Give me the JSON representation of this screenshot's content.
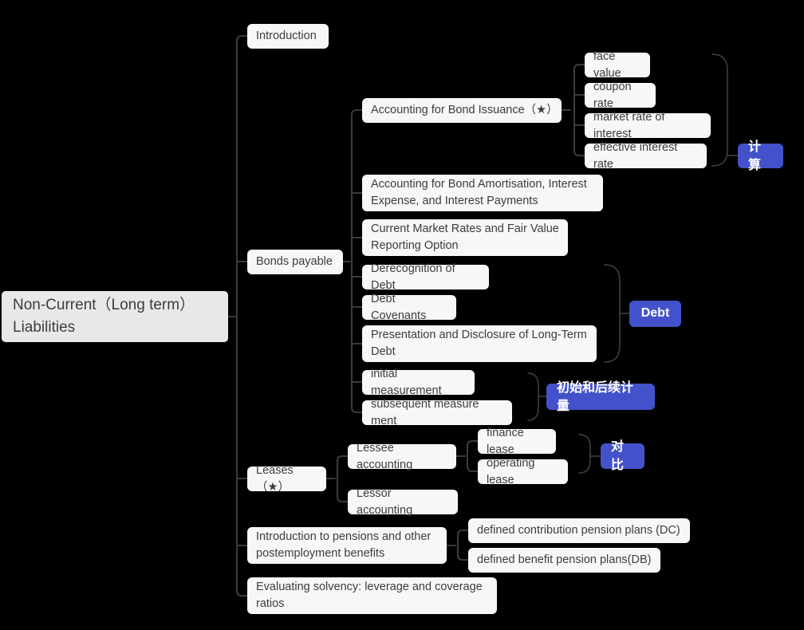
{
  "theme": {
    "background": "#000000",
    "node_bg": "#f7f7f7",
    "node_text": "#3c3c3c",
    "root_bg": "#e8e8e8",
    "badge_bg": "#4352ca",
    "badge_text": "#ffffff",
    "edge_color": "#3a3a3a"
  },
  "root": {
    "label": "Non-Current（Long term）\nLiabilities"
  },
  "branches": [
    {
      "id": "introduction",
      "label": "Introduction"
    },
    {
      "id": "bonds-payable",
      "label": "Bonds payable"
    },
    {
      "id": "leases",
      "label": "Leases（★）"
    },
    {
      "id": "pensions",
      "label": "Introduction to pensions and other\npostemployment benefits"
    },
    {
      "id": "solvency",
      "label": "Evaluating solvency: leverage and coverage\nratios"
    }
  ],
  "bonds_children": [
    {
      "id": "bond-issuance",
      "label": "Accounting for Bond Issuance（★）"
    },
    {
      "id": "bond-amortisation",
      "label": "Accounting for Bond Amortisation, Interest\nExpense, and Interest Payments"
    },
    {
      "id": "current-market-rates",
      "label": "Current Market Rates and Fair Value\nReporting Option"
    },
    {
      "id": "derecognition",
      "label": "Derecognition of Debt"
    },
    {
      "id": "debt-covenants",
      "label": "Debt Covenants"
    },
    {
      "id": "presentation-disclosure",
      "label": "Presentation and Disclosure of Long-Term\nDebt"
    },
    {
      "id": "initial-measurement",
      "label": "initial measurement"
    },
    {
      "id": "subsequent-measurement",
      "label": "subsequent measure ment"
    }
  ],
  "bond_issuance_children": [
    {
      "id": "face-value",
      "label": "face value"
    },
    {
      "id": "coupon-rate",
      "label": "coupon rate"
    },
    {
      "id": "market-rate",
      "label": "market rate of interest"
    },
    {
      "id": "effective-rate",
      "label": "effective interest rate"
    }
  ],
  "leases_children": [
    {
      "id": "lessee-accounting",
      "label": "Lessee accounting"
    },
    {
      "id": "lessor-accounting",
      "label": "Lessor accounting"
    }
  ],
  "lessee_children": [
    {
      "id": "finance-lease",
      "label": "finance lease"
    },
    {
      "id": "operating-lease",
      "label": "operating lease"
    }
  ],
  "pension_children": [
    {
      "id": "defined-contribution",
      "label": "defined contribution pension plans (DC)"
    },
    {
      "id": "defined-benefit",
      "label": "defined benefit pension plans(DB)"
    }
  ],
  "badges": [
    {
      "id": "badge-jisuan",
      "label": "计算",
      "groups": "bond_issuance_children"
    },
    {
      "id": "badge-debt",
      "label": "Debt",
      "groups": "derecognition..presentation-disclosure"
    },
    {
      "id": "badge-measurement",
      "label": "初始和后续计量",
      "groups": "initial+subsequent measurement"
    },
    {
      "id": "badge-duibi",
      "label": "对比",
      "groups": "finance+operating lease"
    }
  ]
}
